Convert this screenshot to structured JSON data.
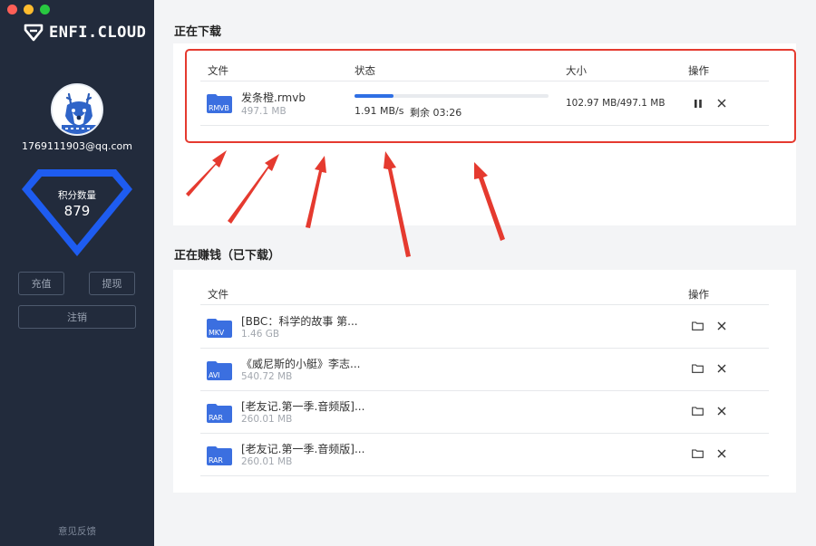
{
  "window": {
    "traffic_colors": [
      "#fe5f57",
      "#febc2e",
      "#28c840"
    ]
  },
  "brand": {
    "name": "ENFI.CLOUD"
  },
  "user": {
    "email": "1769111903@qq.com"
  },
  "points": {
    "label": "积分数量",
    "value": "879"
  },
  "sidebar_buttons": {
    "recharge": "充值",
    "withdraw": "提现",
    "logout": "注销"
  },
  "feedback": "意见反馈",
  "downloading": {
    "title": "正在下载",
    "headers": {
      "file": "文件",
      "status": "状态",
      "size": "大小",
      "action": "操作"
    },
    "item": {
      "name": "发条橙.rmvb",
      "size": "497.1 MB",
      "ext": "RMVB",
      "progress": 0.2,
      "speed": "1.91 MB/s",
      "remaining": "剩余 03:26",
      "progress_text": "102.97 MB/497.1 MB",
      "actions": [
        "pause-icon",
        "close-icon"
      ]
    }
  },
  "earning": {
    "title": "正在赚钱（已下载）",
    "headers": {
      "file": "文件",
      "action": "操作"
    },
    "items": [
      {
        "name": "[BBC：科学的故事 第...",
        "size": "1.46 GB",
        "ext": "MKV"
      },
      {
        "name": "《威尼斯的小艇》李志...",
        "size": "540.72 MB",
        "ext": "AVI"
      },
      {
        "name": "[老友记.第一季.音频版]...",
        "size": "260.01 MB",
        "ext": "RAR"
      },
      {
        "name": "[老友记.第一季.音频版]...",
        "size": "260.01 MB",
        "ext": "RAR"
      }
    ]
  },
  "colors": {
    "accent": "#2f6fe4",
    "sidebar": "#222b3c",
    "highlight": "#e53a2f",
    "folder": "#3b6fe0"
  }
}
